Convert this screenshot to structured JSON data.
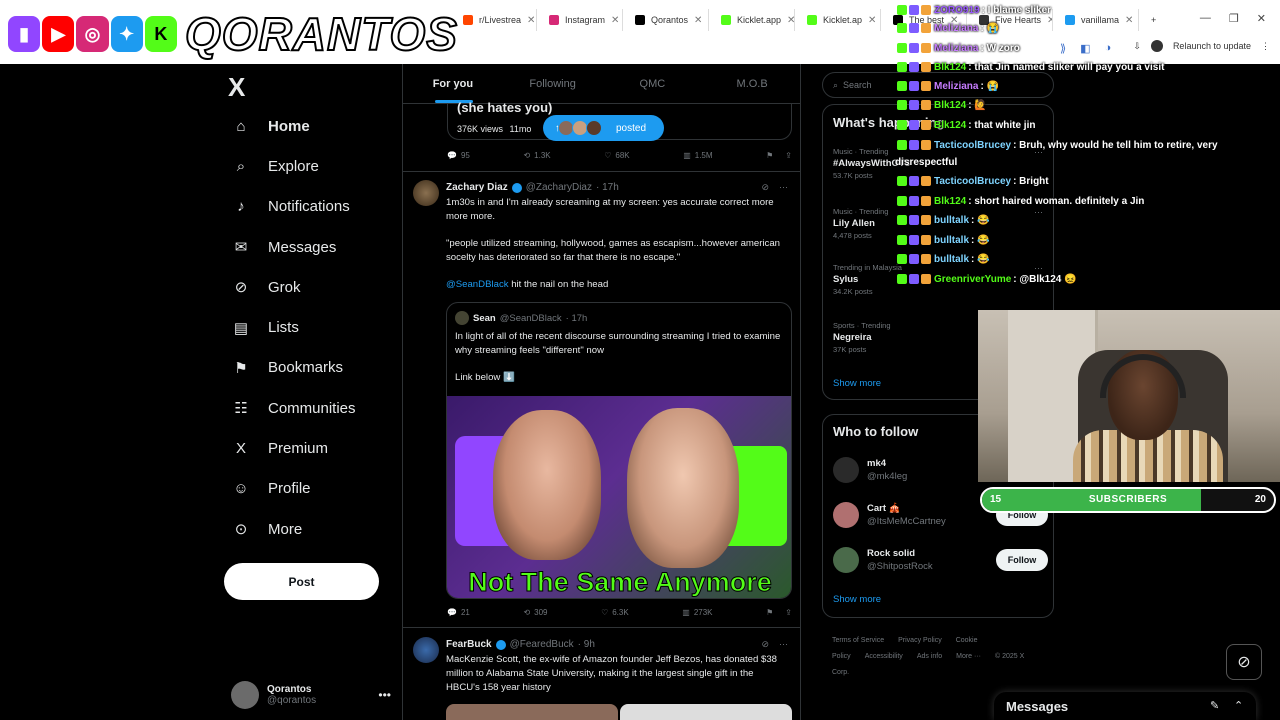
{
  "browser": {
    "tabs": [
      {
        "label": "r/Livestrea",
        "color": "#ff4500"
      },
      {
        "label": "Instagram",
        "color": "#d62976"
      },
      {
        "label": "Qorantos",
        "color": "#000000"
      },
      {
        "label": "Kicklet.app",
        "color": "#53fc18"
      },
      {
        "label": "Kicklet.ap",
        "color": "#53fc18"
      },
      {
        "label": "The best",
        "color": "#000000"
      },
      {
        "label": "Five Hearts",
        "color": "#333333"
      },
      {
        "label": "vanillama",
        "color": "#1d9bf0"
      }
    ],
    "new_tab": "+",
    "relaunch": "Relaunch to update"
  },
  "banner": {
    "name": "QORANTOS",
    "icons": [
      {
        "name": "twitch",
        "color": "#9146ff"
      },
      {
        "name": "youtube",
        "color": "#ff0000"
      },
      {
        "name": "instagram",
        "color": "#d62976"
      },
      {
        "name": "twitter",
        "color": "#1d9bf0"
      },
      {
        "name": "kick",
        "color": "#53fc18"
      }
    ]
  },
  "sidebar": {
    "logo": "X",
    "items": [
      {
        "label": "Home",
        "icon": "home-icon",
        "glyph": "⌂"
      },
      {
        "label": "Explore",
        "icon": "search-icon",
        "glyph": "⌕"
      },
      {
        "label": "Notifications",
        "icon": "bell-icon",
        "glyph": "♪"
      },
      {
        "label": "Messages",
        "icon": "mail-icon",
        "glyph": "✉"
      },
      {
        "label": "Grok",
        "icon": "grok-icon",
        "glyph": "⊘"
      },
      {
        "label": "Lists",
        "icon": "list-icon",
        "glyph": "▤"
      },
      {
        "label": "Bookmarks",
        "icon": "bookmark-icon",
        "glyph": "⚑"
      },
      {
        "label": "Communities",
        "icon": "communities-icon",
        "glyph": "☷"
      },
      {
        "label": "Premium",
        "icon": "x-premium-icon",
        "glyph": "X"
      },
      {
        "label": "Profile",
        "icon": "profile-icon",
        "glyph": "☺"
      },
      {
        "label": "More",
        "icon": "more-circle-icon",
        "glyph": "⊙"
      }
    ],
    "post_label": "Post",
    "account": {
      "name": "Qorantos",
      "handle": "@qorantos",
      "menu": "•••"
    }
  },
  "timeline": {
    "tabs": [
      "For you",
      "Following",
      "QMC",
      "M.O.B"
    ],
    "prev_post": {
      "title": "(she hates you)",
      "views": "376K views",
      "age": "11mo",
      "pill_label": "posted",
      "actions": {
        "replies": "95",
        "reposts": "1.3K",
        "likes": "68K",
        "views": "1.5M"
      }
    },
    "tweet1": {
      "name": "Zachary Diaz",
      "handle": "@ZacharyDiaz",
      "time": "· 17h",
      "text1": "1m30s in and I'm already screaming at my screen: yes accurate correct more more more.",
      "text2": "\"people utilized streaming, hollywood, games as escapism...however american socelty has deteriorated so far that there is no escape.\"",
      "mention": "@SeanDBlack",
      "text3": " hit the nail on the head",
      "quote": {
        "name": "Sean",
        "handle": "@SeanDBlack",
        "time": "· 17h",
        "text": "In light of all of the recent discourse surrounding streaming I tried to examine why streaming feels \"different\" now",
        "link": "Link below ⬇️",
        "thumb_text": "Not The Same Anymore"
      },
      "actions": {
        "replies": "21",
        "reposts": "309",
        "likes": "6.3K",
        "views": "273K"
      }
    },
    "tweet2": {
      "name": "FearBuck",
      "handle": "@FearedBuck",
      "time": "· 9h",
      "text": "MacKenzie Scott, the ex-wife of Amazon founder Jeff Bezos, has donated $38 million to Alabama State University, making it the largest single gift in the HBCU's 158 year history"
    }
  },
  "right": {
    "search_placeholder": "Search",
    "happening_title": "What's happening",
    "trends": [
      {
        "meta": "Music · Trending",
        "title": "#AlwaysWithOT8",
        "posts": "53.7K posts"
      },
      {
        "meta": "Music · Trending",
        "title": "Lily Allen",
        "posts": "4,478 posts"
      },
      {
        "meta": "Trending in Malaysia",
        "title": "Sylus",
        "posts": "34.2K posts"
      },
      {
        "meta": "Sports · Trending",
        "title": "Negreira",
        "posts": "37K posts"
      }
    ],
    "show_more": "Show more",
    "wtf_title": "Who to follow",
    "wtf": [
      {
        "name": "mk4",
        "handle": "@mk4leg",
        "follow": ""
      },
      {
        "name": "Cart 🎪",
        "handle": "@ItsMeMcCartney",
        "follow": "Follow"
      },
      {
        "name": "Rock solid",
        "handle": "@ShitpostRock",
        "follow": "Follow"
      }
    ],
    "footer": [
      "Terms of Service",
      "Privacy Policy",
      "Cookie Policy",
      "Accessibility",
      "Ads info",
      "More ···",
      "© 2025 X Corp."
    ]
  },
  "chat": [
    {
      "user": "ZORO919",
      "text": ": I blame sliker",
      "color": "#9b59ff"
    },
    {
      "user": "Meliziana",
      "text": ": 😭",
      "color": "#c77dff"
    },
    {
      "user": "Meliziana",
      "text": ": W zoro",
      "color": "#c77dff"
    },
    {
      "user": "Blk124",
      "text": ": that Jin named sliker will pay you a visit",
      "color": "#53fc18"
    },
    {
      "user": "Meliziana",
      "text": ": 😭",
      "color": "#c77dff"
    },
    {
      "user": "Blk124",
      "text": ": 🙋",
      "color": "#53fc18"
    },
    {
      "user": "Blk124",
      "text": ": that white jin",
      "color": "#53fc18"
    },
    {
      "user": "TacticoolBrucey",
      "text": ": Bruh, why would he tell him to retire, very",
      "color": "#7fd4ff"
    },
    {
      "user": "",
      "text": "disrespectful",
      "color": "#ffffff"
    },
    {
      "user": "TacticoolBrucey",
      "text": ": Bright",
      "color": "#7fd4ff"
    },
    {
      "user": "Blk124",
      "text": ": short haired woman. definitely a Jin",
      "color": "#53fc18"
    },
    {
      "user": "bulltalk",
      "text": ": 😂",
      "color": "#7fd4ff"
    },
    {
      "user": "bulltalk",
      "text": ": 😂",
      "color": "#7fd4ff"
    },
    {
      "user": "bulltalk",
      "text": ": 😂",
      "color": "#7fd4ff"
    },
    {
      "user": "GreenriverYume",
      "text": ": @Blk124 😖",
      "color": "#53fc18"
    }
  ],
  "subs": {
    "current": "15",
    "label": "SUBSCRIBERS",
    "goal": "20",
    "progress": 0.75,
    "color": "#3cb44a"
  },
  "messages_drawer": {
    "title": "Messages"
  }
}
